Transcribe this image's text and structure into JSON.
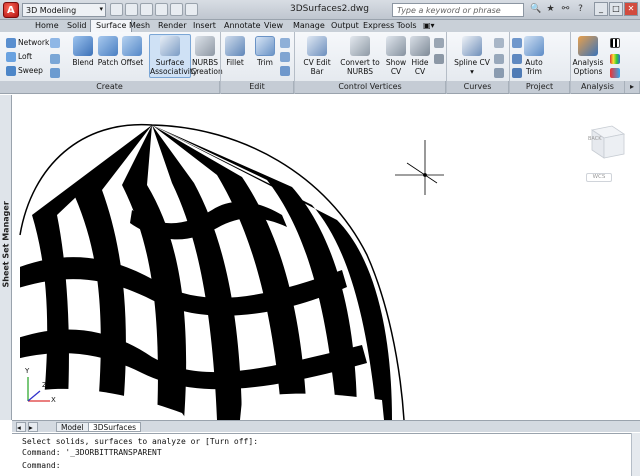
{
  "titlebar": {
    "app_letter": "A",
    "workspace": "3D Modeling",
    "document_title": "3DSurfaces2.dwg",
    "search_placeholder": "Type a keyword or phrase",
    "help_label": "?"
  },
  "ribbon_tabs": [
    "Home",
    "Solid",
    "Surface",
    "Mesh",
    "Render",
    "Insert",
    "Annotate",
    "View",
    "Manage",
    "Output",
    "Express Tools"
  ],
  "active_tab": "Surface",
  "ribbon": {
    "create": {
      "title": "Create",
      "network": "Network",
      "loft": "Loft",
      "sweep": "Sweep",
      "blend": "Blend",
      "patch": "Patch",
      "offset": "Offset",
      "surface_assoc_1": "Surface",
      "surface_assoc_2": "Associativity",
      "nurbs_1": "NURBS",
      "nurbs_2": "Creation"
    },
    "edit": {
      "title": "Edit",
      "fillet": "Fillet",
      "trim": "Trim"
    },
    "control_vertices": {
      "title": "Control Vertices",
      "cv_edit_bar": "CV Edit Bar",
      "convert_1": "Convert to",
      "convert_2": "NURBS",
      "show_1": "Show",
      "show_2": "CV",
      "hide_1": "Hide",
      "hide_2": "CV"
    },
    "curves": {
      "title": "Curves",
      "spline_cv": "Spline CV"
    },
    "project_geometry": {
      "title": "Project Geometry",
      "auto_1": "Auto",
      "auto_2": "Trim"
    },
    "analysis": {
      "title": "Analysis",
      "options_1": "Analysis",
      "options_2": "Options"
    }
  },
  "viewcube": {
    "face": "BACK",
    "wcs": "WCS"
  },
  "side_palette": "Sheet Set Manager",
  "ucs": {
    "x": "X",
    "y": "Y",
    "z": "Z"
  },
  "layout_tabs": [
    "Model",
    "3DSurfaces"
  ],
  "command_line": [
    "Select solids, surfaces to analyze or [Turn off]:",
    "Command: '_3DORBITTRANSPARENT",
    "Command:"
  ]
}
